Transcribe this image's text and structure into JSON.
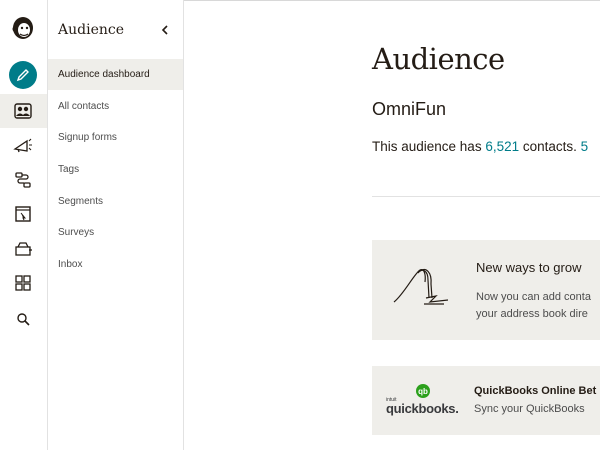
{
  "rail": {
    "icons": [
      "mailchimp-freddie-logo",
      "pencil-icon",
      "audience-icon",
      "campaigns-megaphone-icon",
      "automations-icon",
      "website-icon",
      "content-studio-icon",
      "integrations-grid-icon",
      "search-icon"
    ],
    "accent_color": "#007c89"
  },
  "panel": {
    "title": "Audience",
    "items": [
      {
        "label": "Audience dashboard",
        "active": true
      },
      {
        "label": "All contacts"
      },
      {
        "label": "Signup forms"
      },
      {
        "label": "Tags"
      },
      {
        "label": "Segments"
      },
      {
        "label": "Surveys"
      },
      {
        "label": "Inbox"
      }
    ]
  },
  "main": {
    "title": "Audience",
    "audience_name": "OmniFun",
    "summary_prefix": "This audience has ",
    "contact_count": "6,521",
    "summary_suffix": " contacts. ",
    "summary_trailing": "5",
    "card1": {
      "title": "New ways to grow",
      "line1": "Now you can add conta",
      "line2": "your address book dire"
    },
    "card2": {
      "logo_small": "intuit",
      "logo_word": "quickbooks.",
      "title": "QuickBooks Online Bet",
      "line1": "Sync your QuickBooks "
    }
  }
}
